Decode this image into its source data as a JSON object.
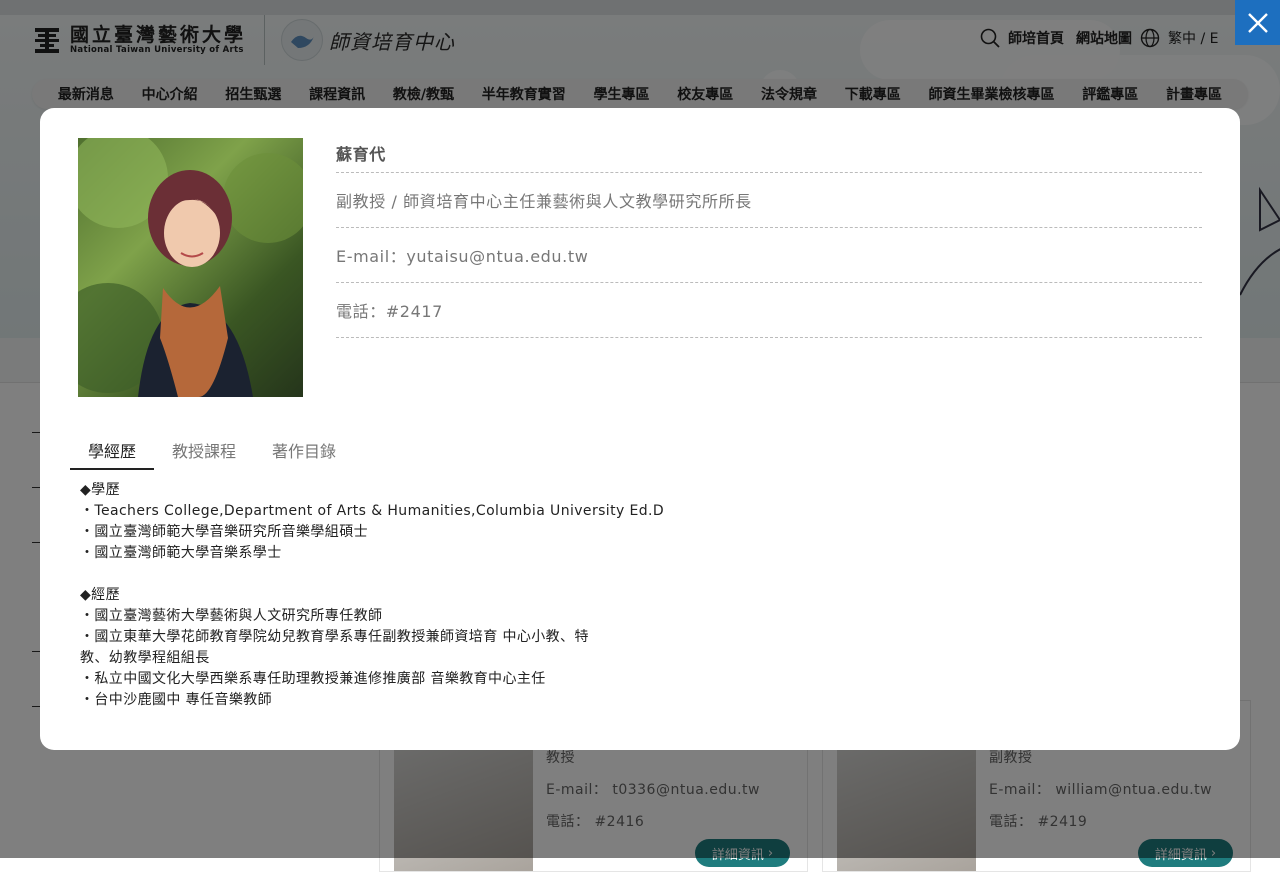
{
  "header": {
    "university_name_zh": "國立臺灣藝術大學",
    "university_name_en": "National Taiwan University of Arts",
    "center_name": "師資培育中心",
    "links": [
      "師培首頁",
      "網站地圖"
    ],
    "language": "繁中 / E"
  },
  "nav": [
    "最新消息",
    "中心介紹",
    "招生甄選",
    "課程資訊",
    "教檢/教甄",
    "半年教育實習",
    "學生專區",
    "校友專區",
    "法令規章",
    "下載專區",
    "師資生畢業檢核專區",
    "評鑑專區",
    "計畫專區"
  ],
  "background_cards": [
    {
      "title": "教授",
      "email": "E-mail： t0336@ntua.edu.tw",
      "phone": "電話： #2416",
      "button": "詳細資訊"
    },
    {
      "title": "副教授",
      "email": "E-mail： william@ntua.edu.tw",
      "phone": "電話： #2419",
      "button": "詳細資訊"
    }
  ],
  "profile": {
    "name": "蘇育代",
    "title": "副教授 / 師資培育中心主任兼藝術與人文教學研究所所長",
    "email": "E-mail：yutaisu@ntua.edu.tw",
    "phone": "電話：#2417"
  },
  "tabs": [
    "學經歷",
    "教授課程",
    "著作目錄"
  ],
  "active_tab": "學經歷",
  "content": {
    "education_heading": "◆學歷",
    "education": [
      "・Teachers College,Department of Arts & Humanities,Columbia University Ed.D",
      "・國立臺灣師範大學音樂研究所音樂學組碩士",
      "・國立臺灣師範大學音樂系學士"
    ],
    "experience_heading": "◆經歷",
    "experience": [
      "・國立臺灣藝術大學藝術與人文研究所專任教師",
      "・國立東華大學花師教育學院幼兒教育學系專任副教授兼師資培育 中心小教、特",
      "教、幼教學程組組長",
      "・私立中國文化大學西樂系專任助理教授兼進修推廣部 音樂教育中心主任",
      "・台中沙鹿國中 專任音樂教師"
    ]
  },
  "colors": {
    "close_button": "#1d6fbf",
    "overlay": "rgba(0,0,0,0.5)",
    "card_button": "#1f7c7e"
  },
  "icons": {
    "close": "close-icon",
    "search": "search-icon",
    "globe": "globe-icon",
    "chevron": "chevron-right-icon"
  }
}
